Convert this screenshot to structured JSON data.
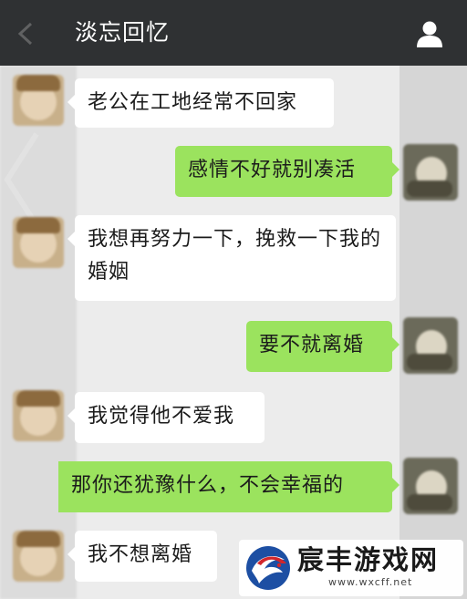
{
  "header": {
    "title": "淡忘回忆"
  },
  "messages": [
    {
      "side": "in",
      "text": "老公在工地经常不回家"
    },
    {
      "side": "out",
      "text": "感情不好就别凑活"
    },
    {
      "side": "in",
      "text": "我想再努力一下，挽救一下我的婚姻"
    },
    {
      "side": "out",
      "text": "要不就离婚"
    },
    {
      "side": "in",
      "text": "我觉得他不爱我"
    },
    {
      "side": "out",
      "text": "那你还犹豫什么，不会幸福的"
    },
    {
      "side": "in",
      "text": "我不想离婚"
    }
  ],
  "watermark": {
    "name": "宸丰游戏网",
    "url": "www.wxcff.net"
  },
  "colors": {
    "header_bg": "#2f3133",
    "chat_bg": "#ececec",
    "incoming_bubble": "#ffffff",
    "outgoing_bubble": "#9be35e",
    "watermark_blue": "#1d4fa3",
    "watermark_red": "#d2262b"
  },
  "icons": {
    "back": "back-arrow-icon",
    "profile": "user-profile-icon",
    "watermark_logo": "dragon-logo"
  }
}
